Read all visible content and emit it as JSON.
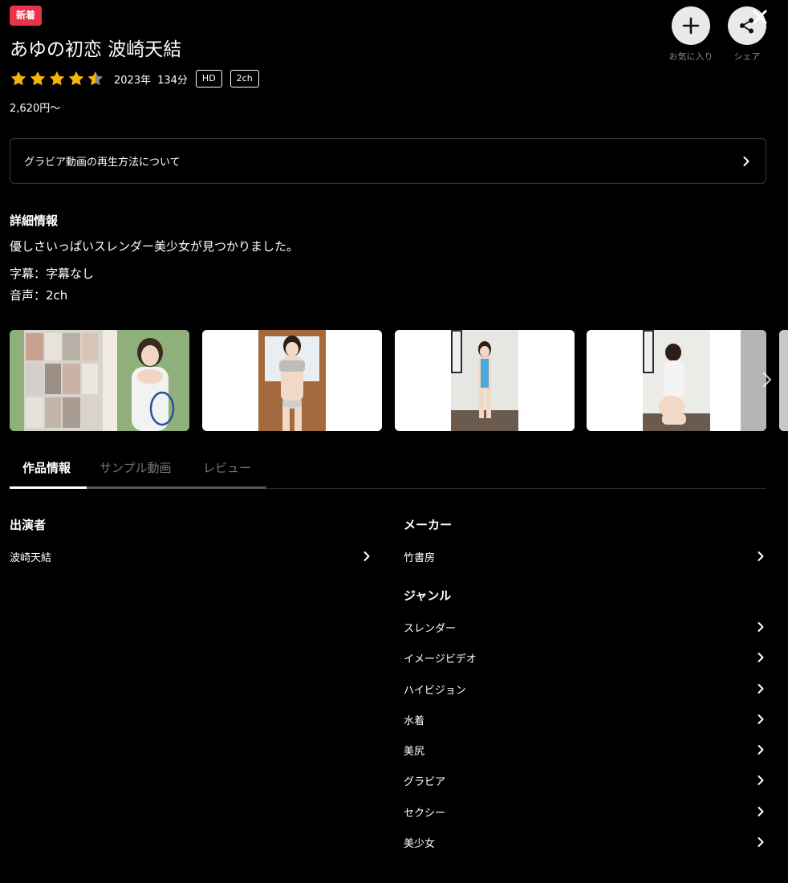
{
  "badge": "新着",
  "title": "あゆの初恋 波崎天結",
  "rating": 4.5,
  "year": "2023年",
  "duration": "134分",
  "tags": [
    "HD",
    "2ch"
  ],
  "price": "2,620円～",
  "actions": {
    "favorite_label": "お気に入り",
    "share_label": "シェア"
  },
  "play_help": "グラビア動画の再生方法について",
  "details": {
    "heading": "詳細情報",
    "description": "優しさいっぱいスレンダー美少女が見つかりました。",
    "subtitles": "字幕：字幕なし",
    "audio": "音声：2ch"
  },
  "tabs": [
    {
      "label": "作品情報",
      "active": true
    },
    {
      "label": "サンプル動画",
      "active": false
    },
    {
      "label": "レビュー",
      "active": false
    }
  ],
  "cast": {
    "heading": "出演者",
    "items": [
      "波崎天結"
    ]
  },
  "maker": {
    "heading": "メーカー",
    "items": [
      "竹書房"
    ]
  },
  "genre": {
    "heading": "ジャンル",
    "items": [
      "スレンダー",
      "イメージビデオ",
      "ハイビジョン",
      "水着",
      "美尻",
      "グラビア",
      "セクシー",
      "美少女"
    ]
  },
  "colors": {
    "badge": "#e8354b",
    "star": "#f5b50a",
    "star_empty": "#888888",
    "background": "#000000"
  }
}
